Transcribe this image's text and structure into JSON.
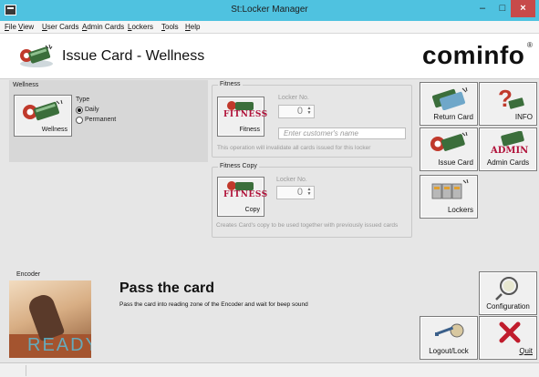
{
  "window": {
    "title": "St:Locker Manager",
    "minimize": "–",
    "maximize": "□",
    "close": "×"
  },
  "menu": [
    "File",
    "View",
    "User Cards",
    "Admin Cards",
    "Lockers",
    "Tools",
    "Help"
  ],
  "header": {
    "title": "Issue Card - Wellness",
    "logo": "cominfo",
    "logo_mark": "®"
  },
  "wellness": {
    "panel_label": "Wellness",
    "button_label": "Wellness",
    "type_label": "Type",
    "options": [
      "Daily",
      "Permanent"
    ],
    "selected": "Daily"
  },
  "fitness": {
    "group_title": "Fitness",
    "button_logo": "FITNESS",
    "button_label": "Fitness",
    "locker_label": "Locker No.",
    "locker_value": "0",
    "name_placeholder": "Enter customer's name",
    "hint": "This operation will invalidate all cards issued for this locker"
  },
  "fitness_copy": {
    "group_title": "Fitness Copy",
    "button_logo": "FITNESS",
    "button_label": "Copy",
    "locker_label": "Locker No.",
    "locker_value": "0",
    "hint": "Creates Card's copy to be used together with previously issued cards"
  },
  "encoder": {
    "panel_label": "Encoder",
    "title": "Pass the card",
    "description": "Pass the card into reading zone of the Encoder and wait for beep sound",
    "image_text": "READY"
  },
  "side_buttons": {
    "return_card": "Return Card",
    "info": "INFO",
    "issue_card": "Issue Card",
    "admin_cards": "Admin Cards",
    "admin_logo": "ADMIN",
    "lockers": "Lockers",
    "configuration": "Configuration",
    "logout": "Logout/Lock",
    "quit": "Quit"
  },
  "colors": {
    "titlebar": "#4fc2e0",
    "close": "#c74a4a",
    "fitness_brand": "#b1123a",
    "quit_x": "#c01c2c"
  }
}
